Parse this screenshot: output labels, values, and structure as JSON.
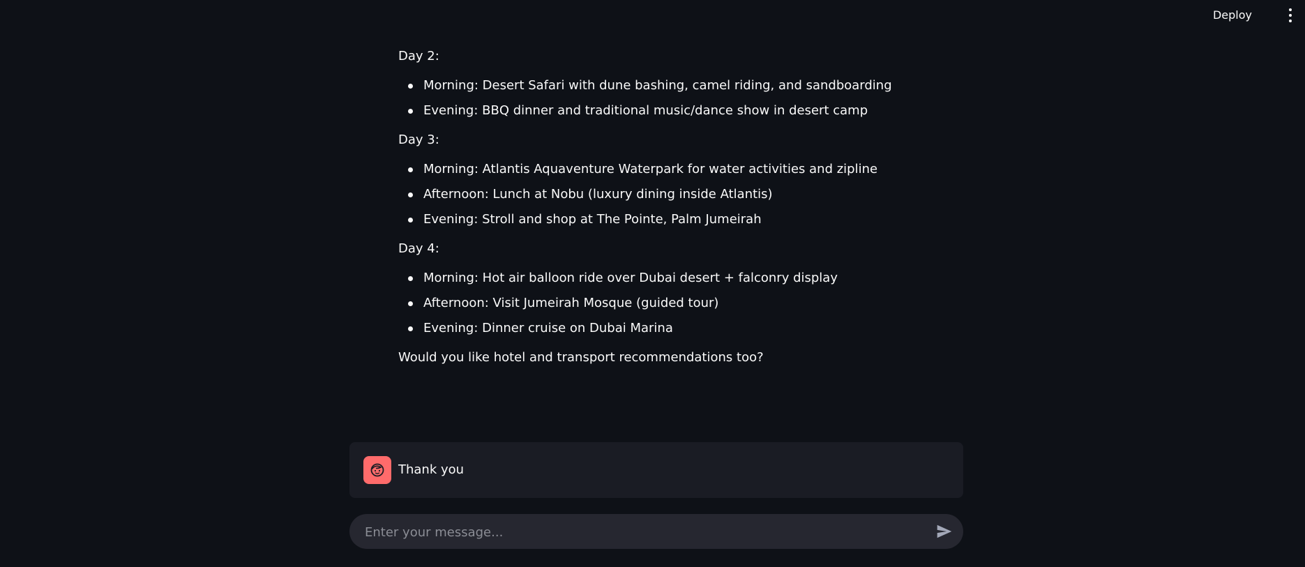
{
  "header": {
    "deploy_label": "Deploy",
    "menu_icon": "kebab-menu-icon"
  },
  "conversation": {
    "assistant_message": {
      "days": [
        {
          "label": "Day 2:",
          "items": [
            "Morning: Desert Safari with dune bashing, camel riding, and sandboarding",
            "Evening: BBQ dinner and traditional music/dance show in desert camp"
          ]
        },
        {
          "label": "Day 3:",
          "items": [
            "Morning: Atlantis Aquaventure Waterpark for water activities and zipline",
            "Afternoon: Lunch at Nobu (luxury dining inside Atlantis)",
            "Evening: Stroll and shop at The Pointe, Palm Jumeirah"
          ]
        },
        {
          "label": "Day 4:",
          "items": [
            "Morning: Hot air balloon ride over Dubai desert + falconry display",
            "Afternoon: Visit Jumeirah Mosque (guided tour)",
            "Evening: Dinner cruise on Dubai Marina"
          ]
        }
      ],
      "closing_question": "Would you like hotel and transport recommendations too?"
    },
    "user_message": {
      "text": "Thank you",
      "avatar_icon": "user-face-icon",
      "avatar_color": "#ff6b6b"
    }
  },
  "chat_input": {
    "placeholder": "Enter your message...",
    "value": "",
    "send_icon": "send-icon"
  },
  "colors": {
    "background": "#0e1117",
    "text": "#fafafa",
    "message_bg": "#1a1c24",
    "input_bg": "#262730"
  }
}
